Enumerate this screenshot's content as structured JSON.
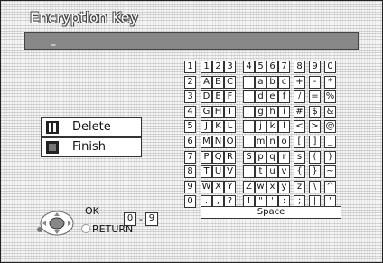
{
  "title": "Encryption Key",
  "key_field": {
    "value": "_"
  },
  "actions": [
    {
      "label": "Delete",
      "icon": "pause-icon"
    },
    {
      "label": "Finish",
      "icon": "stop-icon"
    }
  ],
  "keyboard": {
    "rows": [
      [
        "1",
        "1",
        "2",
        "3",
        "4",
        "5",
        "6",
        "7",
        "8",
        "9",
        "0"
      ],
      [
        "2",
        "A",
        "B",
        "C",
        " ",
        "a",
        "b",
        "c",
        "+",
        "-",
        "*"
      ],
      [
        "3",
        "D",
        "E",
        "F",
        " ",
        "d",
        "e",
        "f",
        "/",
        "=",
        "%"
      ],
      [
        "4",
        "G",
        "H",
        "I",
        " ",
        "g",
        "h",
        "i",
        "#",
        "$",
        "&"
      ],
      [
        "5",
        "J",
        "K",
        "L",
        " ",
        "j",
        "k",
        "l",
        "<",
        ">",
        "@"
      ],
      [
        "6",
        "M",
        "N",
        "O",
        " ",
        "m",
        "n",
        "o",
        "[",
        "]",
        "_"
      ],
      [
        "7",
        "P",
        "Q",
        "R",
        "S",
        "p",
        "q",
        "r",
        "s",
        "(",
        ")"
      ],
      [
        "8",
        "T",
        "U",
        "V",
        " ",
        "t",
        "u",
        "v",
        "{",
        "}",
        "~"
      ],
      [
        "9",
        "W",
        "X",
        "Y",
        "Z",
        "w",
        "x",
        "y",
        "z",
        "\\",
        "^"
      ],
      [
        "0",
        ".",
        ",",
        "?",
        "!",
        "\"",
        "'",
        ":",
        ";",
        "|",
        "'"
      ]
    ],
    "space_label": "Space"
  },
  "footer": {
    "ok_label": "OK",
    "return_label": "RETURN",
    "range_from": "0",
    "range_sep": "-",
    "range_to": "9"
  }
}
